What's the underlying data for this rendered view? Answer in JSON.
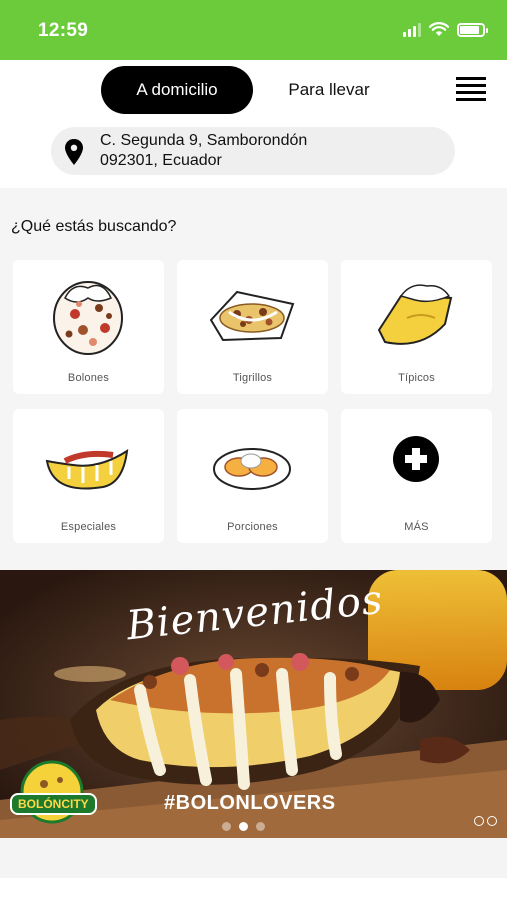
{
  "status_bar": {
    "time": "12:59",
    "battery_level": 0.85,
    "signal_bars": 3
  },
  "header": {
    "tab_active": "A domicilio",
    "tab_inactive": "Para llevar"
  },
  "address": {
    "line1": "C. Segunda 9, Samborondón",
    "line2": "092301, Ecuador"
  },
  "section": {
    "title": "¿Qué estás buscando?",
    "categories": [
      {
        "label": "Bolones",
        "icon": "bolon-icon"
      },
      {
        "label": "Tigrillos",
        "icon": "tigrillo-icon"
      },
      {
        "label": "Típicos",
        "icon": "tipicos-icon"
      },
      {
        "label": "Especiales",
        "icon": "especiales-icon"
      },
      {
        "label": "Porciones",
        "icon": "porciones-icon"
      },
      {
        "label": "MÁS",
        "icon": "plus-circle-icon"
      }
    ]
  },
  "banner": {
    "title": "Bienvenidos",
    "hashtag": "#BOLONLOVERS",
    "brand": "BOLÓNCITY",
    "slide_count": 3,
    "active_slide": 2
  },
  "colors": {
    "status_bar": "#6ccb3b",
    "primary": "#000000",
    "background_grey": "#f5f5f5",
    "address_pill": "#efefef"
  }
}
